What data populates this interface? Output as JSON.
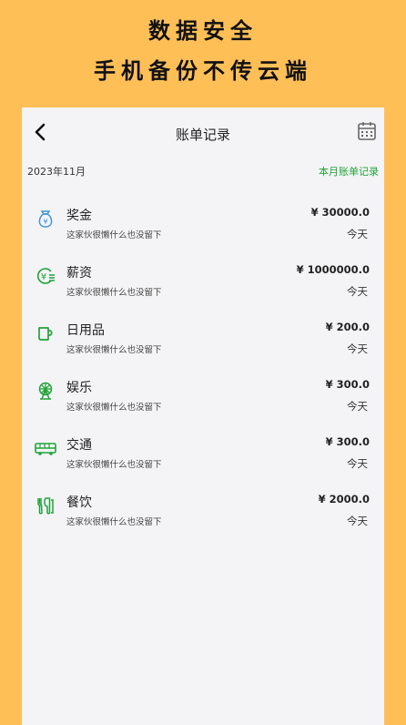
{
  "promo": {
    "line1": "数据安全",
    "line2": "手机备份不传云端"
  },
  "navbar": {
    "title": "账单记录",
    "back_icon": "chevron-left-icon",
    "calendar_icon": "calendar-icon"
  },
  "summary": {
    "month": "2023年11月",
    "link": "本月账单记录"
  },
  "colors": {
    "background": "#FFBF57",
    "accent_green": "#1FA338",
    "icon_blue": "#3C95D8"
  },
  "records": [
    {
      "name": "奖金",
      "desc": "这家伙很懒什么也没留下",
      "amount": "¥ 30000.0",
      "date": "今天",
      "icon": "money-bag-icon"
    },
    {
      "name": "薪资",
      "desc": "这家伙很懒什么也没留下",
      "amount": "¥ 1000000.0",
      "date": "今天",
      "icon": "yen-coin-icon"
    },
    {
      "name": "日用品",
      "desc": "这家伙很懒什么也没留下",
      "amount": "¥ 200.0",
      "date": "今天",
      "icon": "cup-icon"
    },
    {
      "name": "娱乐",
      "desc": "这家伙很懒什么也没留下",
      "amount": "¥ 300.0",
      "date": "今天",
      "icon": "ferris-wheel-icon"
    },
    {
      "name": "交通",
      "desc": "这家伙很懒什么也没留下",
      "amount": "¥ 300.0",
      "date": "今天",
      "icon": "bus-icon"
    },
    {
      "name": "餐饮",
      "desc": "这家伙很懒什么也没留下",
      "amount": "¥ 2000.0",
      "date": "今天",
      "icon": "utensils-icon"
    }
  ]
}
